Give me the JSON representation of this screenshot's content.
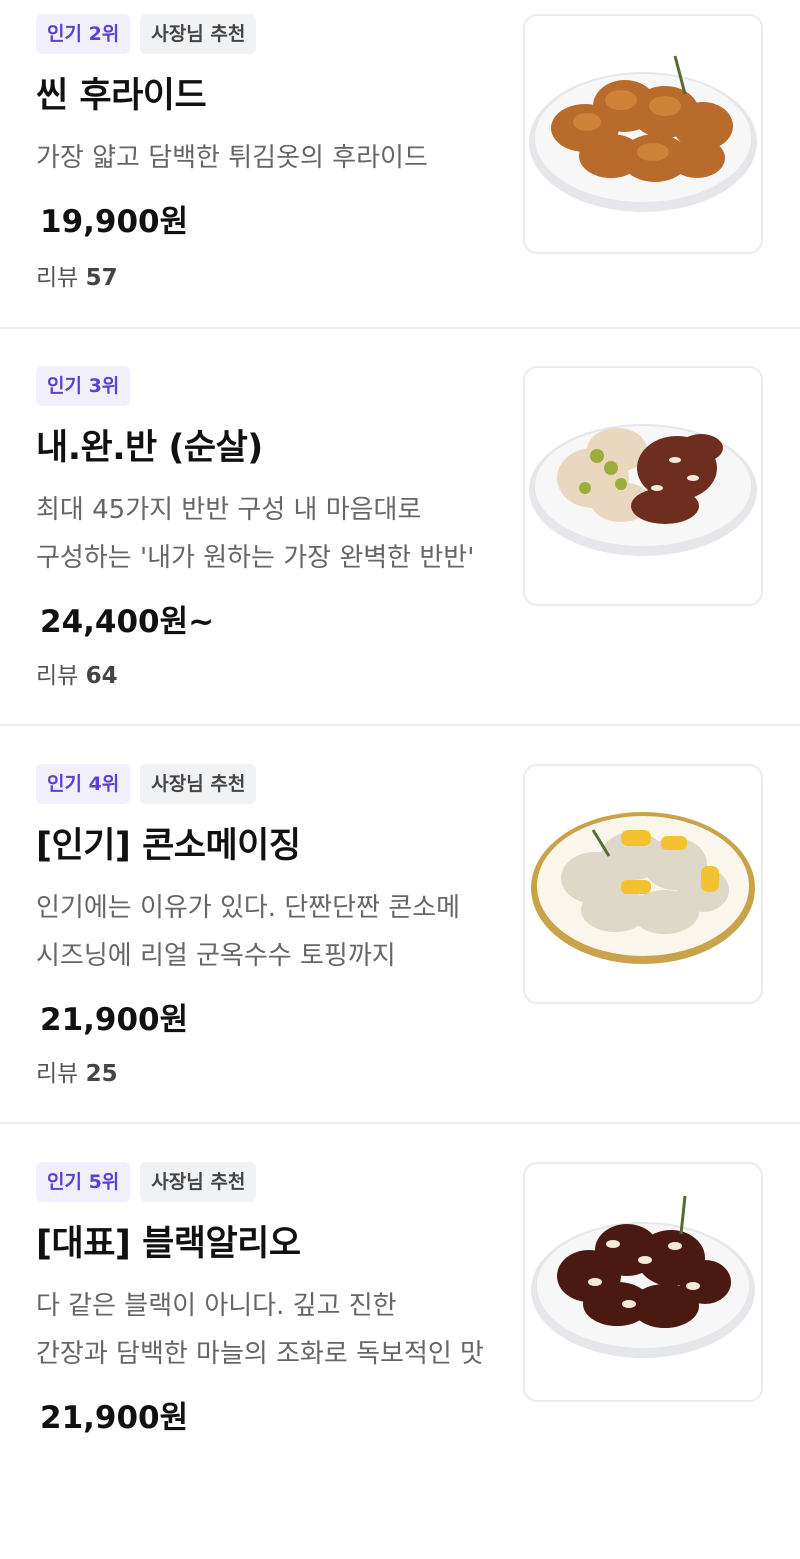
{
  "menu_items": [
    {
      "badges": [
        "인기 2위",
        "사장님 추천"
      ],
      "name": "씬 후라이드",
      "desc_lines": [
        "가장 얇고 담백한 튀김옷의 후라이드"
      ],
      "price": "19,900원",
      "review_label": "리뷰",
      "review_count": "57",
      "image": "fried-chicken-plate"
    },
    {
      "badges": [
        "인기 3위"
      ],
      "name": "내.완.반 (순살)",
      "desc_lines": [
        "최대 45가지 반반 구성 내 마음대로",
        "구성하는 '내가 원하는 가장 완벽한 반반'"
      ],
      "price": "24,400원~",
      "review_label": "리뷰",
      "review_count": "64",
      "image": "half-half-boneless-plate"
    },
    {
      "badges": [
        "인기 4위",
        "사장님 추천"
      ],
      "name": "[인기] 콘소메이징",
      "desc_lines": [
        "인기에는 이유가 있다. 단짠단짠 콘소메",
        "시즈닝에 리얼 군옥수수 토핑까지"
      ],
      "price": "21,900원",
      "review_label": "리뷰",
      "review_count": "25",
      "image": "consomme-corn-chicken-plate"
    },
    {
      "badges": [
        "인기 5위",
        "사장님 추천"
      ],
      "name": "[대표] 블랙알리오",
      "desc_lines": [
        "다 같은 블랙이 아니다. 깊고 진한",
        "간장과 담백한 마늘의 조화로 독보적인 맛"
      ],
      "price": "21,900원",
      "review_label": "",
      "review_count": "",
      "image": "black-alio-chicken-plate"
    }
  ],
  "colors": {
    "rank_badge_bg": "#f1effb",
    "rank_badge_text": "#5d3fd3",
    "rec_badge_bg": "#f1f2f4",
    "divider": "#eeeeef"
  }
}
